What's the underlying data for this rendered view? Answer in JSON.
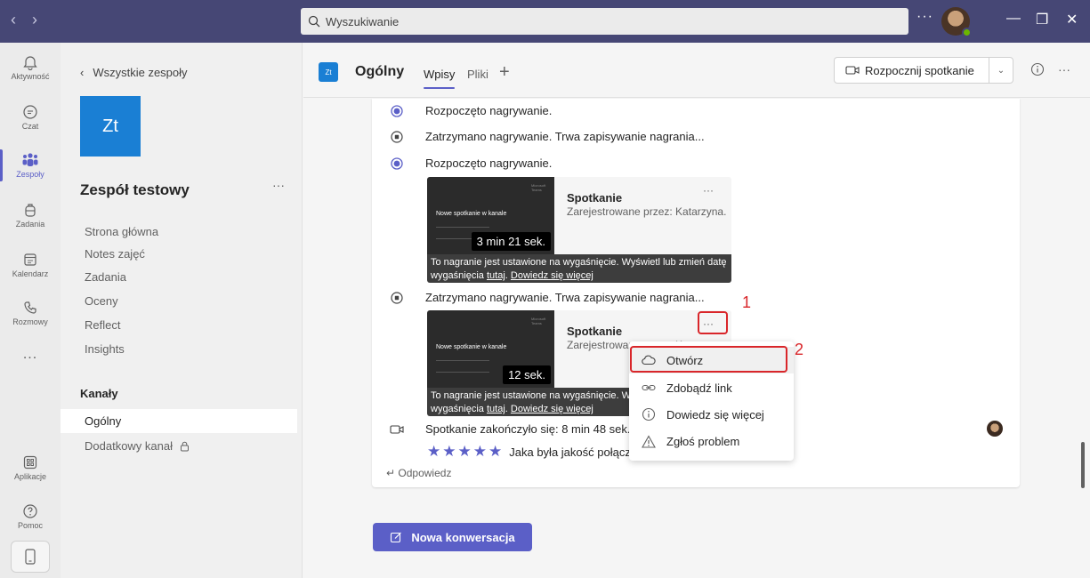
{
  "search": {
    "placeholder": "Wyszukiwanie"
  },
  "rail": {
    "items": [
      {
        "label": "Aktywność"
      },
      {
        "label": "Czat"
      },
      {
        "label": "Zespoły"
      },
      {
        "label": "Zadania"
      },
      {
        "label": "Kalendarz"
      },
      {
        "label": "Rozmowy"
      },
      {
        "label": "Aplikacje"
      },
      {
        "label": "Pomoc"
      }
    ],
    "more": "..."
  },
  "sidebar": {
    "back": "Wszystkie zespoły",
    "team_initials": "Zt",
    "team_name": "Zespół testowy",
    "links": [
      "Strona główna",
      "Notes zajęć",
      "Zadania",
      "Oceny",
      "Reflect",
      "Insights"
    ],
    "channels_title": "Kanały",
    "channels": [
      "Ogólny",
      "Dodatkowy kanał"
    ]
  },
  "header": {
    "icon": "Zt",
    "title": "Ogólny",
    "tabs": [
      "Wpisy",
      "Pliki"
    ],
    "meet_button": "Rozpocznij spotkanie"
  },
  "events": [
    "Rozpoczęto nagrywanie.",
    "Zatrzymano nagrywanie. Trwa zapisywanie nagrania...",
    "Rozpoczęto nagrywanie.",
    "Zatrzymano nagrywanie. Trwa zapisywanie nagrania...",
    "Spotkanie zakończyło się: 8 min 48 sek."
  ],
  "recordings": [
    {
      "title": "Spotkanie",
      "subtitle": "Zarejestrowane przez: Katarzyna...",
      "thumb_title": "Nowe spotkanie w kanale",
      "thumb_brand": "Microsoft Teams",
      "duration": "3 min 21 sek.",
      "note_text": "To nagranie jest ustawione na wygaśnięcie. Wyświetl lub zmień datę wygaśnięcia ",
      "note_link1": "tutaj",
      "note_sep": ". ",
      "note_link2": "Dowiedz się więcej"
    },
    {
      "title": "Spotkanie",
      "subtitle": "Zarejestrowane przez: Katarzyna...",
      "thumb_title": "Nowe spotkanie w kanale",
      "thumb_brand": "Microsoft Teams",
      "duration": "12 sek.",
      "note_text": "To nagranie jest ustawione na wygaśnięcie. Wyświetl lub zmień datę wygaśnięcia ",
      "note_link1": "tutaj",
      "note_sep": ". ",
      "note_link2": "Dowiedz się więcej"
    }
  ],
  "rating": {
    "text": "Jaka była jakość połączenia?",
    "stars": 5
  },
  "reply": "Odpowiedz",
  "new_conversation": "Nowa konwersacja",
  "menu": {
    "items": [
      {
        "label": "Otwórz",
        "icon": "cloud-icon"
      },
      {
        "label": "Zdobądź link",
        "icon": "link-icon"
      },
      {
        "label": "Dowiedz się więcej",
        "icon": "info-icon"
      },
      {
        "label": "Zgłoś problem",
        "icon": "warning-icon"
      }
    ]
  },
  "annotations": {
    "step1": "1",
    "step2": "2",
    "color": "#d9262a"
  },
  "colors": {
    "brand": "#5b5fc7",
    "titlebar": "#464775",
    "team_tile": "#1a7fd4"
  }
}
